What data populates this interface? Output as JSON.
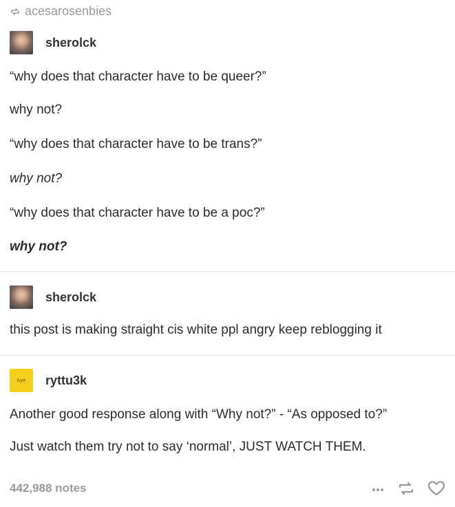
{
  "reblog": {
    "from": "acesarosenbies",
    "icon": "reblog-icon"
  },
  "post1": {
    "username": "sherolck",
    "lines": [
      "“why does that character have to be queer?”",
      "why not?",
      "“why does that character have to be trans?”",
      "why not?",
      "“why does that character have to be a poc?”",
      "why not?"
    ]
  },
  "post2": {
    "username": "sherolck",
    "text": "this post is making straight cis white ppl angry keep reblogging it"
  },
  "post3": {
    "username": "ryttu3k",
    "avatar_text": "bye",
    "lines": [
      "Another good response along with “Why not?” - “As opposed to?”",
      "Just watch them try not to say ‘normal’, JUST WATCH THEM."
    ]
  },
  "footer": {
    "notes": "442,988 notes",
    "icons": [
      "more-icon",
      "reblog-icon",
      "heart-icon"
    ]
  },
  "colors": {
    "muted": "#9a9a9a",
    "text": "#2c2c2c",
    "divider": "#e3e3e3",
    "avatar_yellow": "#f4cf1e"
  }
}
